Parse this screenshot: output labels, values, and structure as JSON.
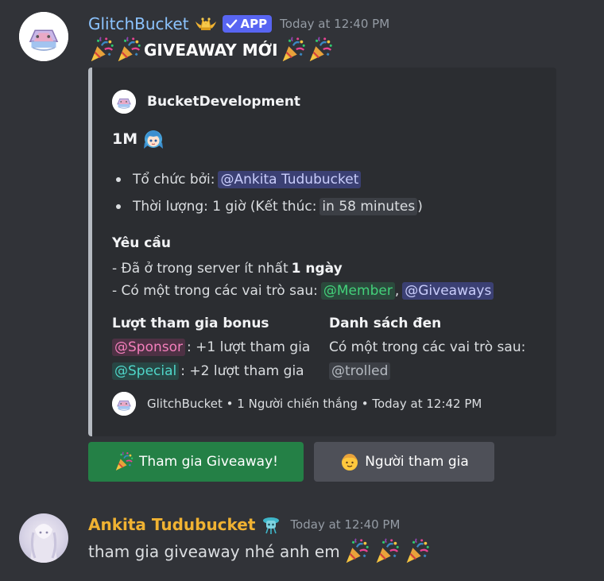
{
  "messages": [
    {
      "username": "GlitchBucket",
      "app_badge": "APP",
      "timestamp": "Today at 12:40 PM",
      "content": "GIVEAWAY MỚI",
      "embed": {
        "author": "BucketDevelopment",
        "title": "1M",
        "host_label": "Tổ chức bởi:",
        "host_mention": "@Ankita Tudubucket",
        "duration_label": "Thời lượng: 1 giờ (Kết thúc:",
        "duration_relative": "in 58 minutes",
        "duration_close": ")",
        "requirements_heading": "Yêu cầu",
        "req_server_text": "- Đã ở trong server ít nhất",
        "req_server_bold": "1 ngày",
        "req_roles_text": "- Có một trong các vai trò sau:",
        "req_role_1": "@Member",
        "req_role_sep": ",",
        "req_role_2": "@Giveaways",
        "bonus_heading": "Lượt tham gia bonus",
        "bonus_role_1": "@Sponsor",
        "bonus_text_1": ": +1 lượt tham gia",
        "bonus_role_2": "@Special",
        "bonus_text_2": ": +2 lượt tham gia",
        "blacklist_heading": "Danh sách đen",
        "blacklist_text": "Có một trong các vai trò sau:",
        "blacklist_role": "@trolled",
        "footer": "GlitchBucket • 1 Người chiến thắng • Today at 12:42 PM"
      },
      "buttons": {
        "join": "Tham gia Giveaway!",
        "participants": "Người tham gia"
      }
    },
    {
      "username": "Ankita Tudubucket",
      "timestamp": "Today at 12:40 PM",
      "content": "tham gia giveaway nhé anh em"
    }
  ],
  "colors": {
    "background": "#313338",
    "embed_background": "#2b2d31",
    "app_badge": "#5865f2",
    "join_button": "#248046",
    "secondary_button": "#4e5058",
    "bot_name": "#8cc4ff",
    "user_name": "#f0b232"
  },
  "icons": {
    "bot_avatar": "bucket-logo-icon",
    "role_icon": "crown-wings-icon",
    "app_check": "check-icon",
    "party_popper": "party-popper-icon",
    "title_emoji": "anime-girl-emoji-icon",
    "participants": "person-emoji-icon",
    "user_role_icon": "robot-role-icon"
  }
}
